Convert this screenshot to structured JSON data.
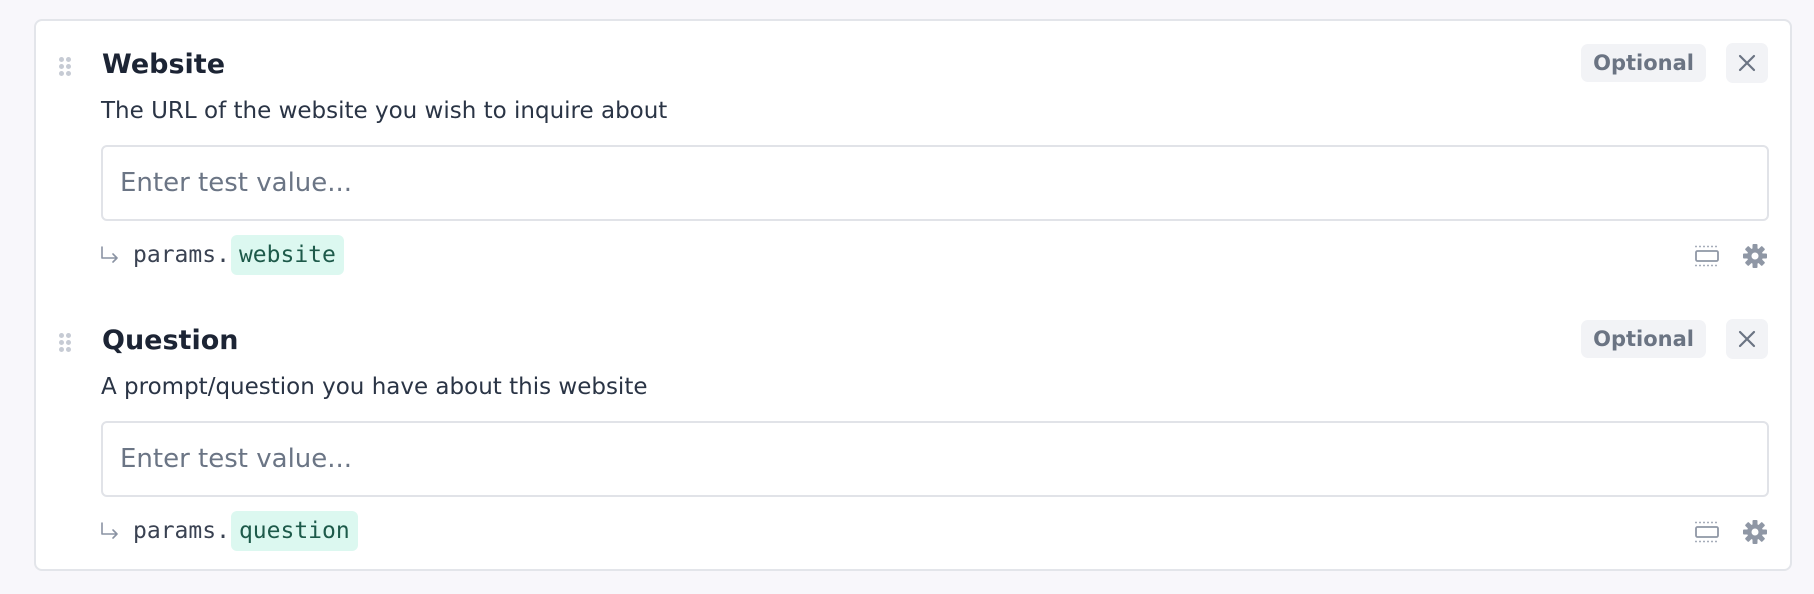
{
  "params": [
    {
      "title": "Website",
      "badge": "Optional",
      "description": "The URL of the website you wish to inquire about",
      "placeholder": "Enter test value...",
      "path_prefix": "params.",
      "path_key": "website"
    },
    {
      "title": "Question",
      "badge": "Optional",
      "description": "A prompt/question you have about this website",
      "placeholder": "Enter test value...",
      "path_prefix": "params.",
      "path_key": "question"
    }
  ],
  "icons": {
    "drag": "drag-handle-icon",
    "close": "close-icon",
    "arrow": "return-arrow-icon",
    "input_mode": "input-mode-icon",
    "settings": "gear-icon"
  },
  "colors": {
    "accent_highlight": "#dcf8f0",
    "accent_text": "#1d5a4a",
    "title_text": "#1c2434",
    "muted_text": "#6b7483"
  }
}
